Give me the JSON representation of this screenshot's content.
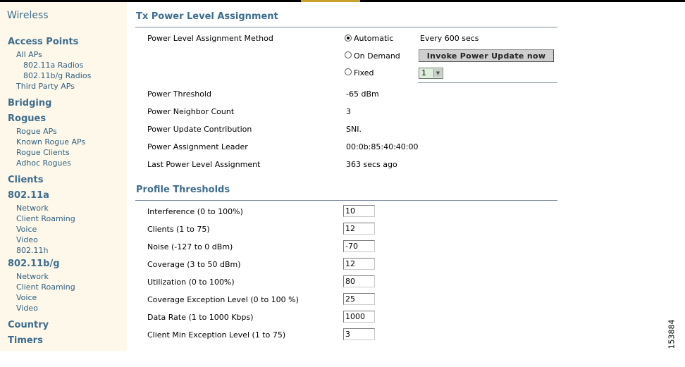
{
  "sidebar": {
    "title": "Wireless",
    "access_points": {
      "label": "Access Points",
      "items": [
        "All APs",
        "802.11a Radios",
        "802.11b/g Radios",
        "Third Party APs"
      ]
    },
    "bridging": "Bridging",
    "rogues": {
      "label": "Rogues",
      "items": [
        "Rogue APs",
        "Known Rogue APs",
        "Rogue Clients",
        "Adhoc Rogues"
      ]
    },
    "clients": "Clients",
    "a": {
      "label": "802.11a",
      "items": [
        "Network",
        "Client Roaming",
        "Voice",
        "Video",
        "802.11h"
      ]
    },
    "bg": {
      "label": "802.11b/g",
      "items": [
        "Network",
        "Client Roaming",
        "Voice",
        "Video"
      ]
    },
    "country": "Country",
    "timers": "Timers"
  },
  "tx": {
    "title": "Tx Power Level Assignment",
    "method_label": "Power Level Assignment Method",
    "automatic": "Automatic",
    "interval": "Every 600 secs",
    "on_demand": "On Demand",
    "invoke_button": "Invoke Power Update now",
    "fixed": "Fixed",
    "fixed_value": "1",
    "selected_method": "Automatic",
    "rows": [
      {
        "label": "Power Threshold",
        "value": "-65 dBm"
      },
      {
        "label": "Power Neighbor Count",
        "value": "3"
      },
      {
        "label": "Power Update Contribution",
        "value": "SNI."
      },
      {
        "label": "Power Assignment Leader",
        "value": "00:0b:85:40:40:00"
      },
      {
        "label": "Last Power Level Assignment",
        "value": "363 secs ago"
      }
    ]
  },
  "profile": {
    "title": "Profile Thresholds",
    "rows": [
      {
        "label": "Interference (0 to 100%)",
        "value": "10"
      },
      {
        "label": "Clients (1 to 75)",
        "value": "12"
      },
      {
        "label": "Noise (-127 to 0 dBm)",
        "value": "-70"
      },
      {
        "label": "Coverage (3 to 50 dBm)",
        "value": "12"
      },
      {
        "label": "Utilization (0 to 100%)",
        "value": "80"
      },
      {
        "label": "Coverage Exception Level (0 to 100 %)",
        "value": "25"
      },
      {
        "label": "Data Rate (1 to 1000 Kbps)",
        "value": "1000"
      },
      {
        "label": "Client Min Exception Level (1 to 75)",
        "value": "3"
      }
    ]
  },
  "figure_id": "153884",
  "colors": {
    "link": "#3e6d8e",
    "sidebar_bg": "#fdf8ea",
    "accent": "#c8a02c"
  }
}
